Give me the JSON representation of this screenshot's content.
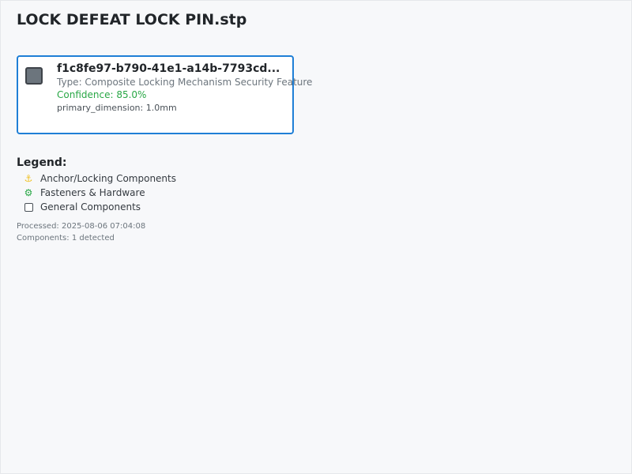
{
  "page": {
    "title": "LOCK DEFEAT LOCK PIN.stp"
  },
  "component": {
    "id": "f1c8fe97-b790-41e1-a14b-7793cd...",
    "type": "Type: Composite Locking Mechanism Security Feature",
    "confidence": "Confidence: 85.0%",
    "dimension": "primary_dimension: 1.0mm",
    "icon_color": "#6c757d",
    "border_color": "#1f7fd6"
  },
  "legend": {
    "title": "Legend:",
    "items": [
      {
        "icon": "anchor-icon",
        "glyph": "⚓",
        "label": "Anchor/Locking Components",
        "color": "#f0c020"
      },
      {
        "icon": "gear-icon",
        "glyph": "⚙",
        "label": "Fasteners & Hardware",
        "color": "#28a745"
      },
      {
        "icon": "box-icon",
        "glyph": "",
        "label": "General Components",
        "color": "#495057"
      }
    ]
  },
  "meta": {
    "processed": "Processed: 2025-08-06 07:04:08",
    "components": "Components: 1 detected"
  }
}
